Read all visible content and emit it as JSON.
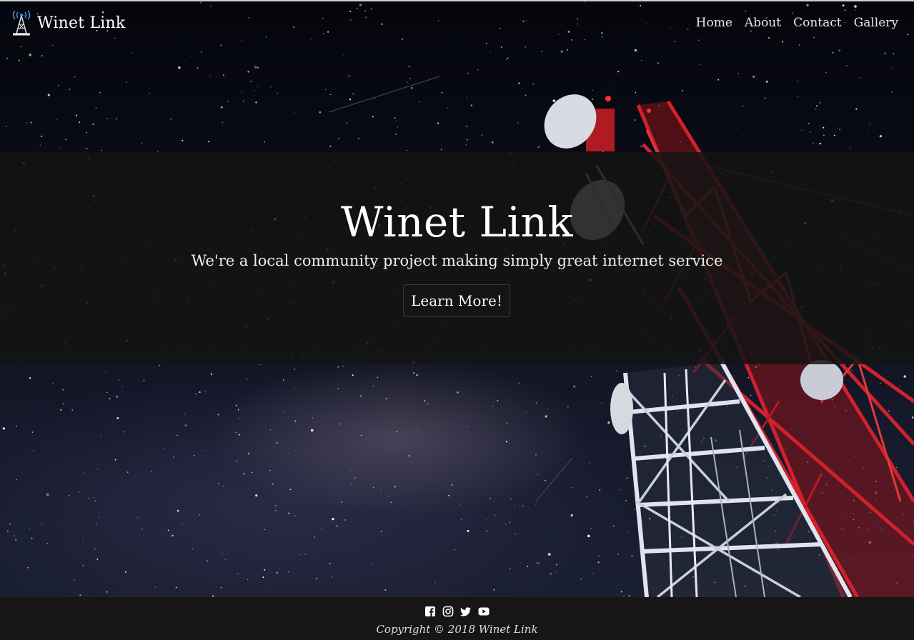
{
  "brand": {
    "name": "Winet Link",
    "logo_icon": "radio-tower-icon"
  },
  "nav": {
    "items": [
      {
        "label": "Home"
      },
      {
        "label": "About"
      },
      {
        "label": "Contact"
      },
      {
        "label": "Gallery"
      }
    ]
  },
  "hero": {
    "title": "Winet Link",
    "subtitle": "We're a local community project making simply great internet service",
    "button_label": "Learn More!",
    "background": "night-sky-with-telecom-tower"
  },
  "footer": {
    "social_icons": [
      "facebook-icon",
      "instagram-icon",
      "twitter-icon",
      "youtube-icon"
    ],
    "copyright": "Copyright © 2018 Winet Link"
  },
  "colors": {
    "band": "#141414",
    "footer": "#161616",
    "text": "#ffffff",
    "tower_red": "#c8202a",
    "tower_white": "#d8dde8"
  }
}
